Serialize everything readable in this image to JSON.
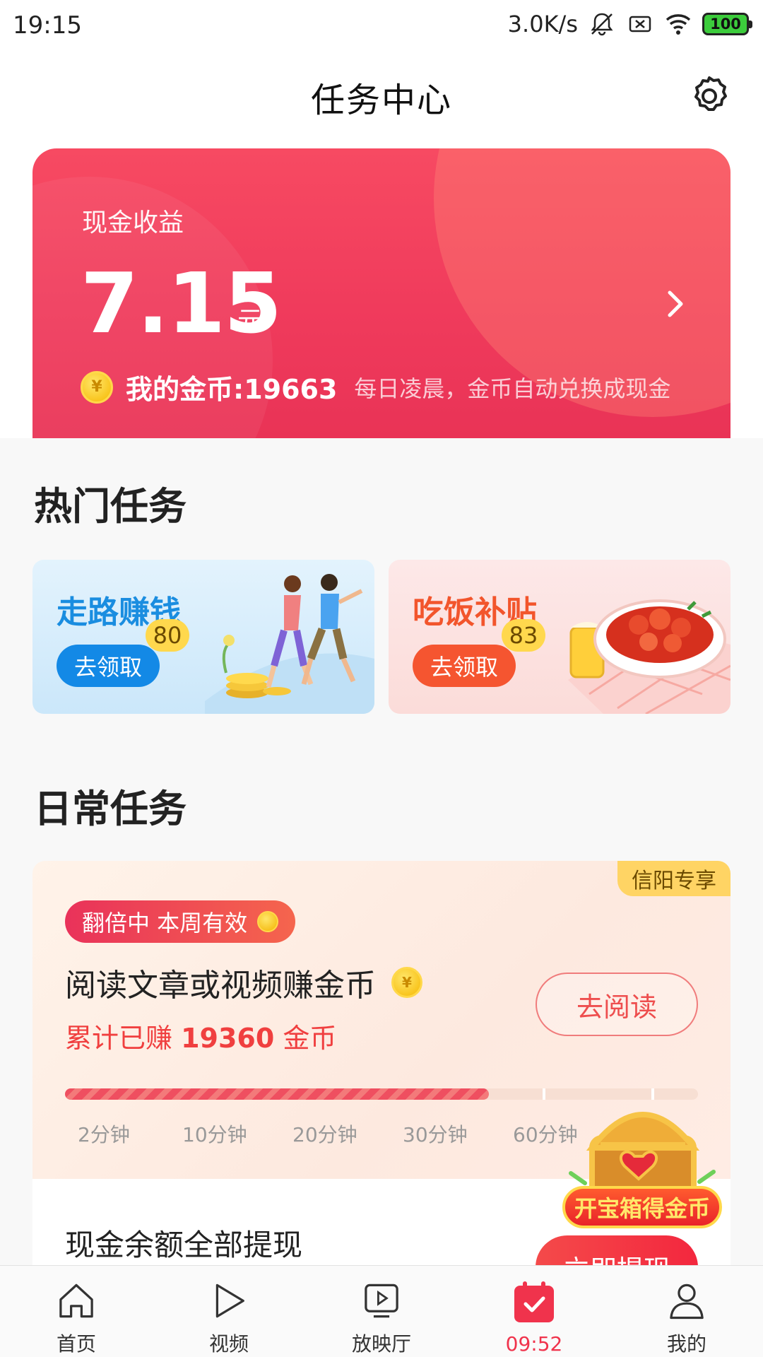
{
  "status_bar": {
    "time": "19:15",
    "net_speed": "3.0K/s",
    "battery": "100"
  },
  "header": {
    "title": "任务中心",
    "settings_icon": "gear-icon"
  },
  "earnings": {
    "label": "现金收益",
    "amount": "7.15",
    "unit": "元",
    "coins_text": "我的金币:19663",
    "coins_note": "每日凌晨，金币自动兑换成现金",
    "coin_symbol": "¥"
  },
  "hot_tasks": {
    "title": "热门任务",
    "cards": [
      {
        "title": "走路赚钱",
        "button": "去领取",
        "badge": "80"
      },
      {
        "title": "吃饭补贴",
        "button": "去领取",
        "badge": "83"
      }
    ]
  },
  "daily_tasks": {
    "title": "日常任务",
    "region_tag": "信阳专享",
    "double_pill": "翻倍中 本周有效",
    "read_task_title": "阅读文章或视频赚金币",
    "earned_prefix": "累计已赚",
    "earned_value": "19360",
    "earned_suffix": "金币",
    "read_button": "去阅读",
    "progress": 0.67,
    "ticks": [
      "2分钟",
      "10分钟",
      "20分钟",
      "30分钟",
      "60分钟"
    ],
    "treasure_label": "开宝箱得金币",
    "withdraw_title": "现金余额全部提现",
    "withdraw_button": "立即提现"
  },
  "bottom_nav": {
    "items": [
      {
        "label": "首页",
        "icon": "home-icon"
      },
      {
        "label": "视频",
        "icon": "play-icon"
      },
      {
        "label": "放映厅",
        "icon": "tv-play-icon"
      },
      {
        "label": "09:52",
        "icon": "calendar-check-icon",
        "active": true
      },
      {
        "label": "我的",
        "icon": "user-icon"
      }
    ]
  },
  "colors": {
    "brand_red": "#f03b5c",
    "active_nav": "#f0334c",
    "walk_blue": "#1389e6",
    "eat_orange": "#f55530"
  }
}
